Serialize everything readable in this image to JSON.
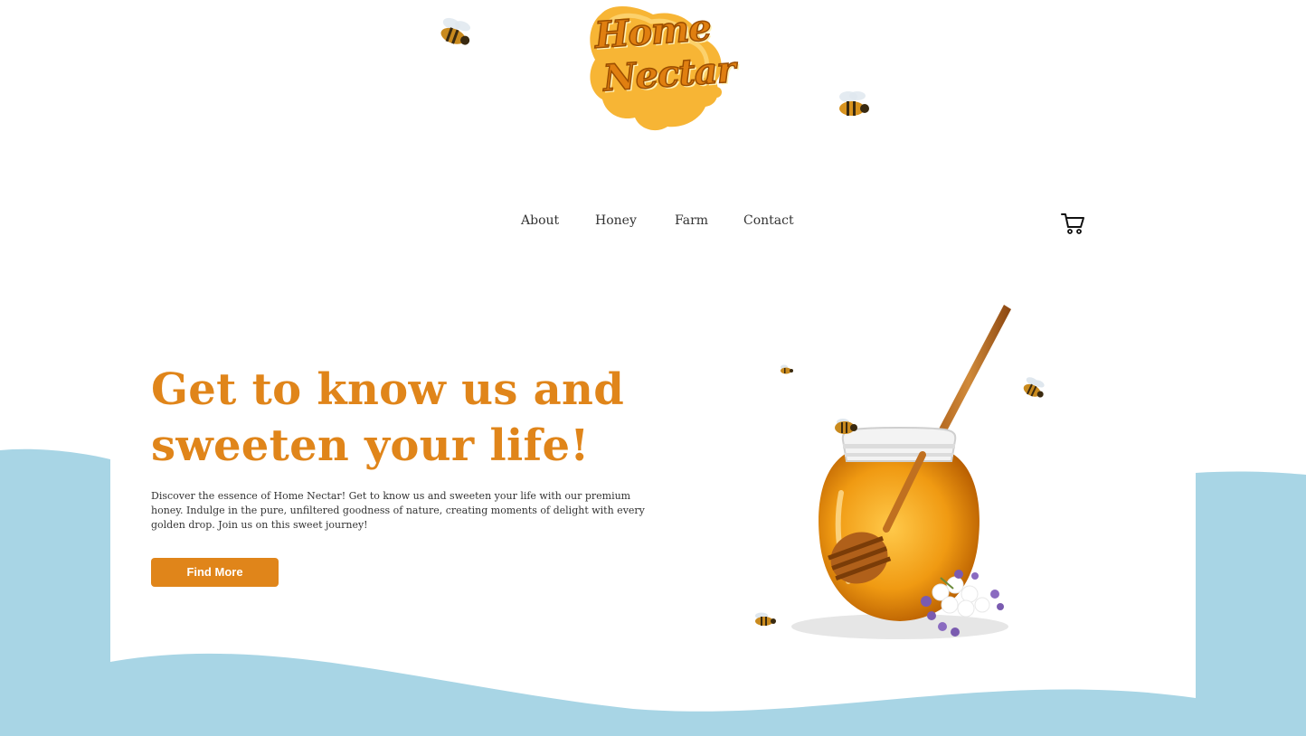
{
  "brand": {
    "logo_line1": "Home",
    "logo_line2": "Nectar"
  },
  "nav": {
    "items": [
      {
        "label": "About"
      },
      {
        "label": "Honey"
      },
      {
        "label": "Farm"
      },
      {
        "label": "Contact"
      }
    ],
    "cart_icon": "shopping-cart-icon"
  },
  "hero": {
    "title_line1": "Get to know us and",
    "title_line2": "sweeten your life!",
    "description": "Discover the essence of Home Nectar! Get to know us and sweeten your life with our premium honey. Indulge in the pure, unfiltered goodness of nature, creating moments of delight with every golden drop. Join us on this sweet journey!",
    "cta_label": "Find More"
  },
  "colors": {
    "accent": "#E0851A",
    "wave": "#A8D5E5",
    "text": "#333333",
    "background": "#FFFFFF"
  },
  "icons": {
    "bee": "bee-icon",
    "honey_jar": "honey-jar-image"
  }
}
